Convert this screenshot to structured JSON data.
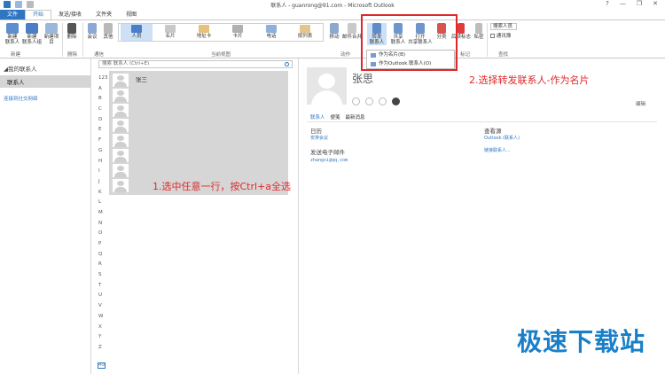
{
  "window": {
    "title": "联系人 - guanrong@91.com - Microsoft Outlook",
    "controls": [
      "?",
      "—",
      "❐",
      "✕"
    ]
  },
  "tabs": [
    "文件",
    "开始",
    "发送/接收",
    "文件夹",
    "视图"
  ],
  "ribbon": {
    "buttons": [
      {
        "label": "新建\n联系人"
      },
      {
        "label": "新建\n联系人组"
      },
      {
        "label": "新建项目"
      },
      {
        "label": "删除"
      },
      {
        "label": "会议"
      },
      {
        "label": "其他"
      }
    ],
    "groups": [
      "新建",
      "删除",
      "通信",
      "当前视图",
      "动作",
      "共享",
      "标记",
      "查找"
    ],
    "views": [
      "人员",
      "名片",
      "地址卡",
      "卡片",
      "电话",
      "按列表"
    ],
    "actions": [
      "移动",
      "邮件合并",
      "转发\n联系人",
      "共享\n联系人",
      "打开\n共享联系人",
      "分类",
      "后续标志",
      "私密"
    ],
    "find": {
      "search_people": "搜索人员",
      "address_book": "通讯簿"
    }
  },
  "forward_menu": [
    "作为名片(B)",
    "作为Outlook 联系人(O)"
  ],
  "nav": {
    "section": "◢我的联系人",
    "item": "联系人",
    "link": "连接到社交网络"
  },
  "list": {
    "search_placeholder": "搜索 联系人 (Ctrl+E)",
    "alphabet": [
      "123",
      "A",
      "B",
      "C",
      "D",
      "E",
      "F",
      "G",
      "H",
      "I",
      "J",
      "K",
      "L",
      "M",
      "N",
      "O",
      "P",
      "Q",
      "R",
      "S",
      "T",
      "U",
      "V",
      "W",
      "X",
      "Y",
      "Z"
    ],
    "first_contact": "张三",
    "bottom_icon": "4⊙"
  },
  "detail": {
    "name": "张思",
    "tabs": [
      "联系人",
      "便笺",
      "最新消息"
    ],
    "edit": "编辑",
    "calendar_label": "日历",
    "calendar_link": "安排会议",
    "email_label": "发送电子邮件",
    "email_value": "zhangsi@qq.com",
    "source_label": "查看源",
    "source_value": "Outlook (联系人)",
    "link_contacts": "链接联系人..."
  },
  "annotations": {
    "step1": "1.选中任意一行，按Ctrl+a全选",
    "step2": "2.选择转发联系人-作为名片"
  },
  "watermark": "极速下载站",
  "colors": {
    "accent": "#2f76c2",
    "annotation": "#e0282a",
    "watermark": "#1a7fc9"
  }
}
